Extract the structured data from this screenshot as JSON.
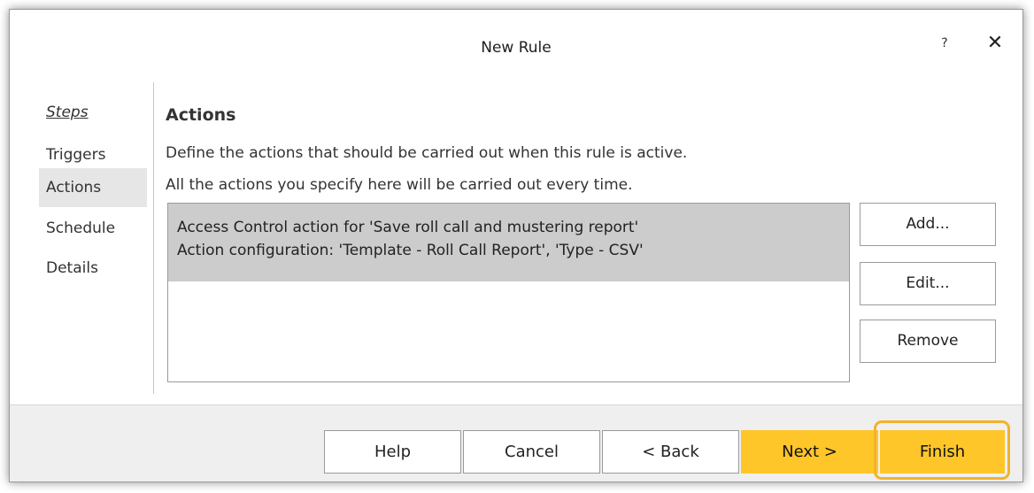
{
  "window": {
    "title": "New Rule",
    "help_label": "?",
    "close_label": "✕"
  },
  "sidebar": {
    "heading": "Steps",
    "items": [
      {
        "label": "Triggers",
        "active": false
      },
      {
        "label": "Actions",
        "active": true
      },
      {
        "label": "Schedule",
        "active": false
      },
      {
        "label": "Details",
        "active": false
      }
    ]
  },
  "main": {
    "title": "Actions",
    "description_line1": "Define the actions that should be carried out when this rule is active.",
    "description_line2": "All the actions you specify here will be carried out every time.",
    "actions_list": [
      {
        "line1": "Access Control action for 'Save roll call and mustering report'",
        "line2": "Action configuration: 'Template - Roll Call Report', 'Type - CSV'",
        "selected": true
      }
    ],
    "buttons": {
      "add": "Add...",
      "edit": "Edit...",
      "remove": "Remove"
    }
  },
  "footer": {
    "help": "Help",
    "cancel": "Cancel",
    "back": "< Back",
    "next": "Next >",
    "finish": "Finish"
  },
  "colors": {
    "accent": "#ffc629",
    "highlight_outline": "#f0b429",
    "selected_row": "#cccccc",
    "active_step": "#e6e6e6"
  }
}
